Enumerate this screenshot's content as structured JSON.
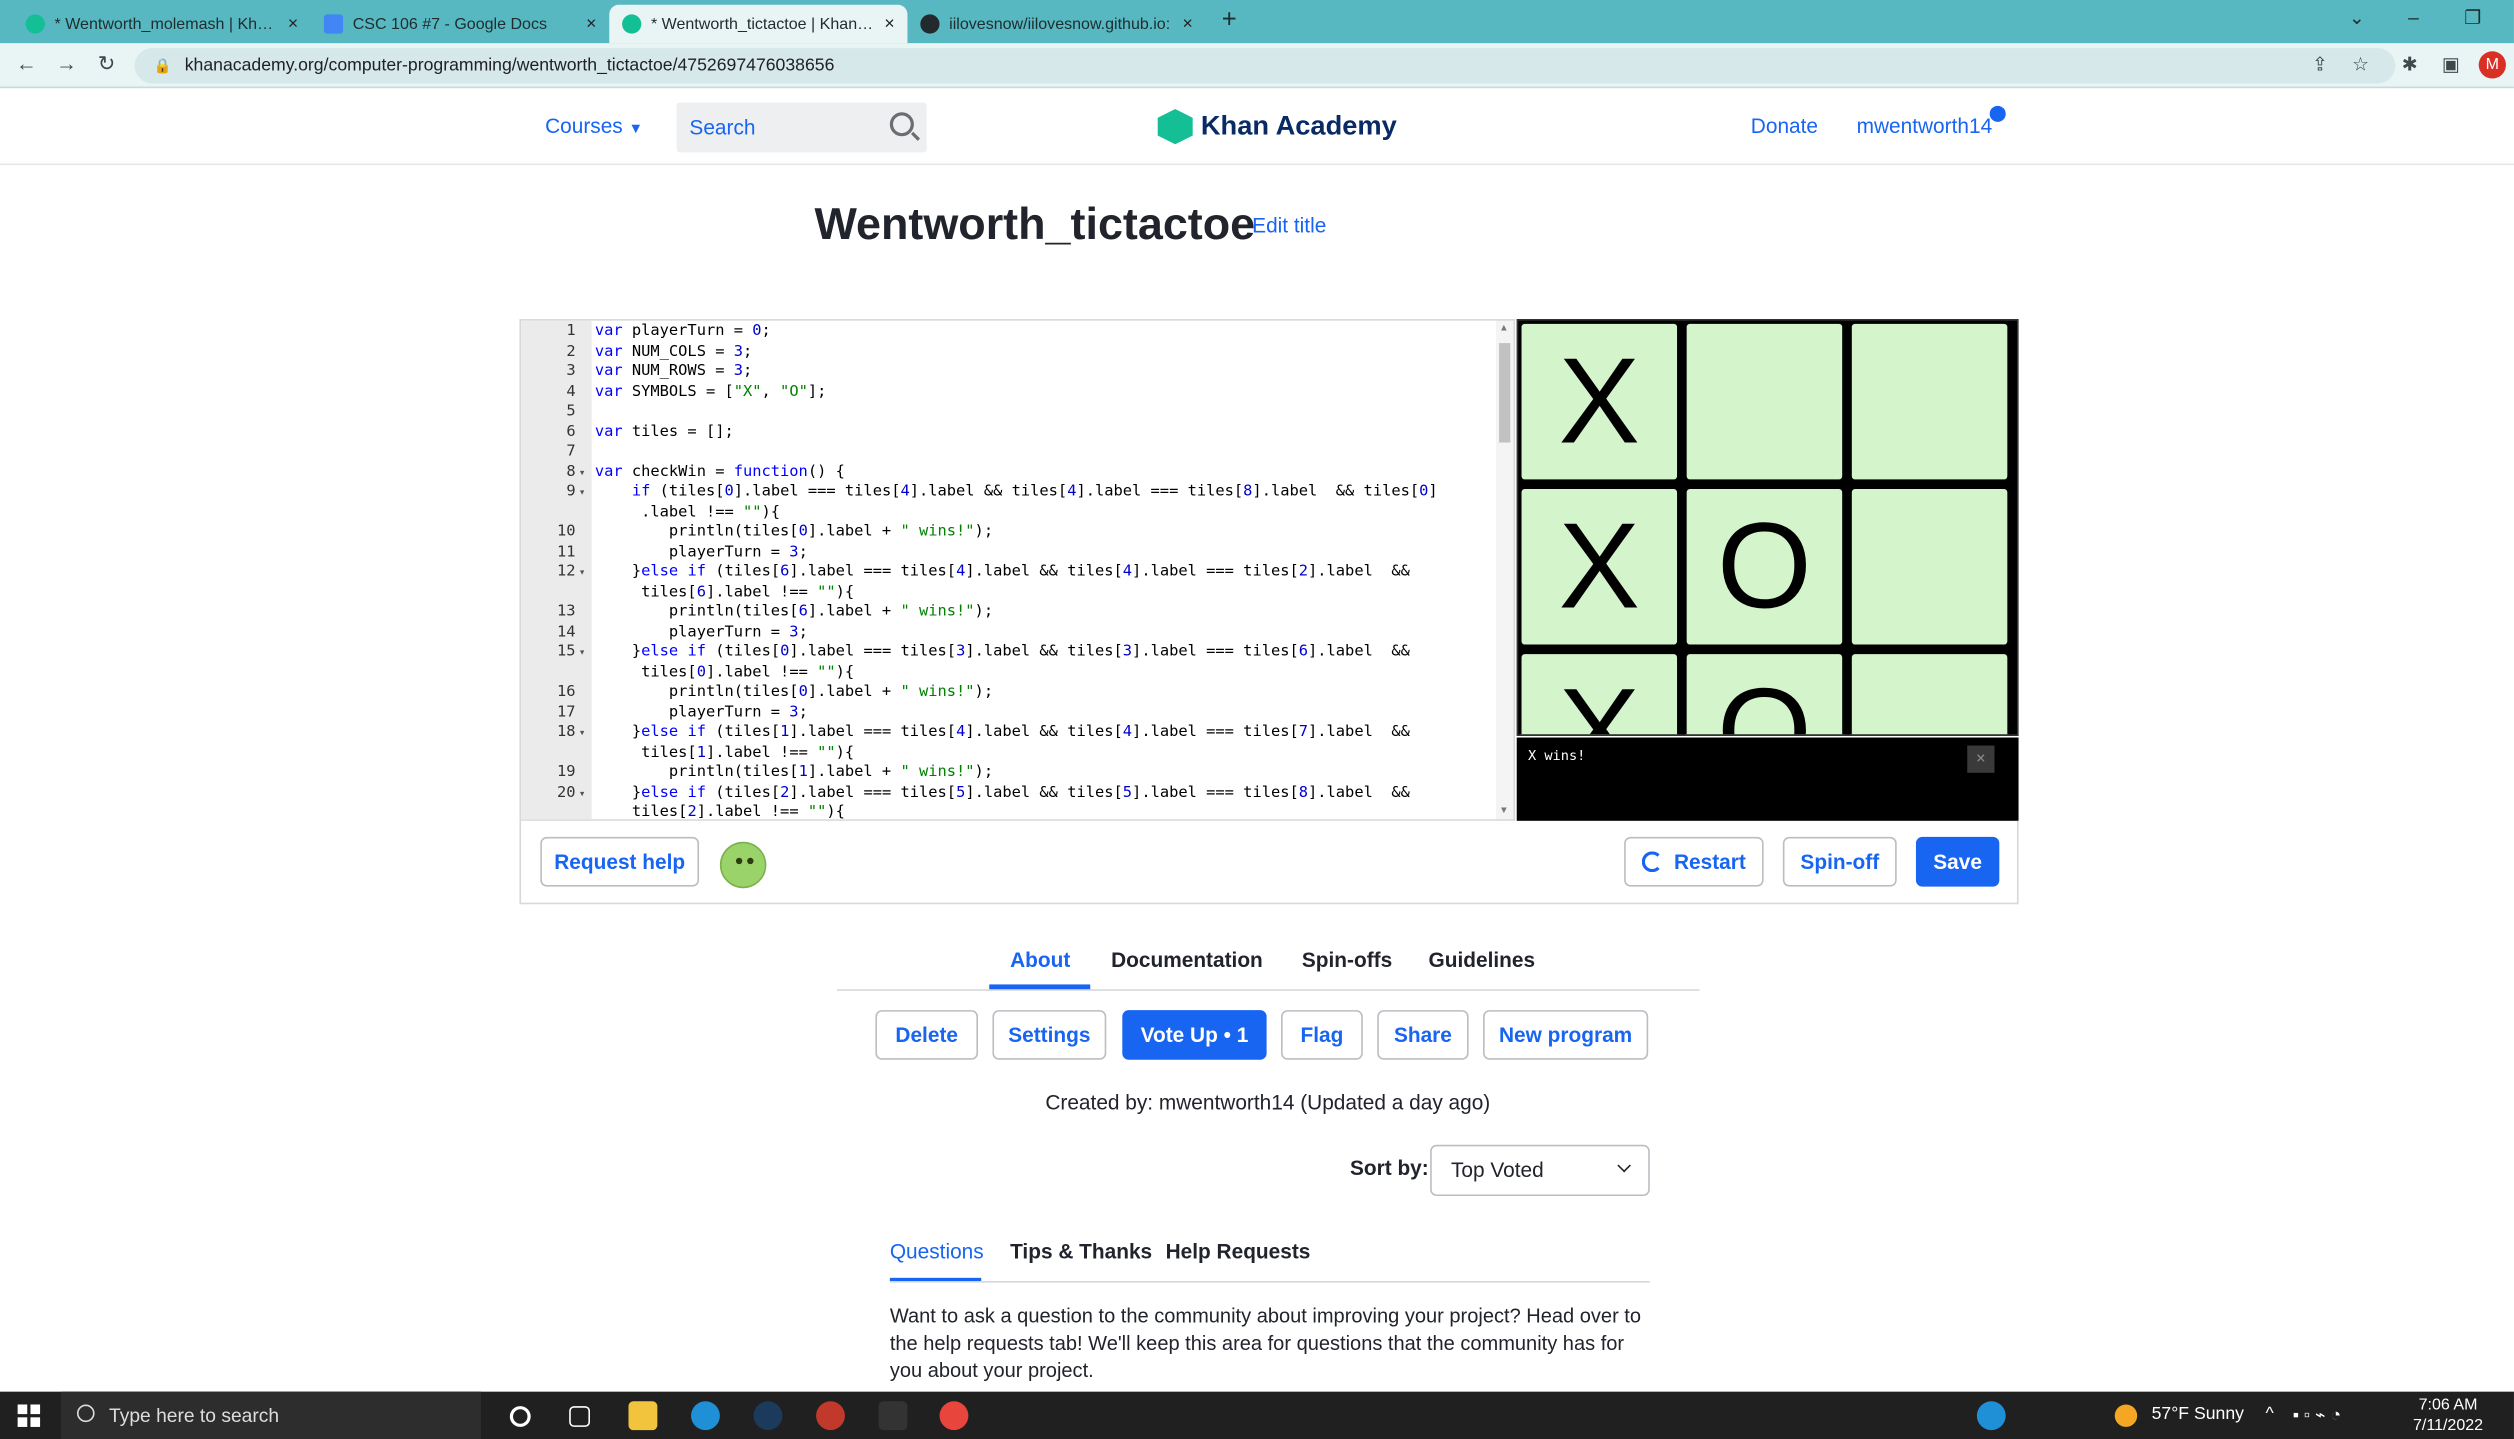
{
  "browser": {
    "tabs": [
      {
        "title": "* Wentworth_molemash | Khan A",
        "active": false
      },
      {
        "title": "CSC 106 #7 - Google Docs",
        "active": false
      },
      {
        "title": "* Wentworth_tictactoe | Khan Ac",
        "active": true
      },
      {
        "title": "iilovesnow/iilovesnow.github.io:",
        "active": false
      }
    ],
    "url": "khanacademy.org/computer-programming/wentworth_tictactoe/4752697476038656",
    "profile_initial": "M"
  },
  "header": {
    "courses": "Courses",
    "search_placeholder": "Search",
    "logo": "Khan Academy",
    "donate": "Donate",
    "username": "mwentworth14"
  },
  "program": {
    "title": "Wentworth_tictactoe",
    "edit_title": "Edit title"
  },
  "code_lines": [
    {
      "n": "1",
      "fold": "",
      "text": "var playerTurn = 0;"
    },
    {
      "n": "2",
      "fold": "",
      "text": "var NUM_COLS = 3;"
    },
    {
      "n": "3",
      "fold": "",
      "text": "var NUM_ROWS = 3;"
    },
    {
      "n": "4",
      "fold": "",
      "text": "var SYMBOLS = [\"X\", \"O\"];"
    },
    {
      "n": "5",
      "fold": "",
      "text": ""
    },
    {
      "n": "6",
      "fold": "",
      "text": "var tiles = [];"
    },
    {
      "n": "7",
      "fold": "",
      "text": ""
    },
    {
      "n": "8",
      "fold": "▾",
      "text": "var checkWin = function() {"
    },
    {
      "n": "9",
      "fold": "▾",
      "text": "    if (tiles[0].label === tiles[4].label && tiles[4].label === tiles[8].label  && tiles[0]"
    },
    {
      "n": "",
      "fold": "",
      "text": "     .label !== \"\"){"
    },
    {
      "n": "10",
      "fold": "",
      "text": "        println(tiles[0].label + \" wins!\");"
    },
    {
      "n": "11",
      "fold": "",
      "text": "        playerTurn = 3;"
    },
    {
      "n": "12",
      "fold": "▾",
      "text": "    }else if (tiles[6].label === tiles[4].label && tiles[4].label === tiles[2].label  &&"
    },
    {
      "n": "",
      "fold": "",
      "text": "     tiles[6].label !== \"\"){"
    },
    {
      "n": "13",
      "fold": "",
      "text": "        println(tiles[6].label + \" wins!\");"
    },
    {
      "n": "14",
      "fold": "",
      "text": "        playerTurn = 3;"
    },
    {
      "n": "15",
      "fold": "▾",
      "text": "    }else if (tiles[0].label === tiles[3].label && tiles[3].label === tiles[6].label  &&"
    },
    {
      "n": "",
      "fold": "",
      "text": "     tiles[0].label !== \"\"){"
    },
    {
      "n": "16",
      "fold": "",
      "text": "        println(tiles[0].label + \" wins!\");"
    },
    {
      "n": "17",
      "fold": "",
      "text": "        playerTurn = 3;"
    },
    {
      "n": "18",
      "fold": "▾",
      "text": "    }else if (tiles[1].label === tiles[4].label && tiles[4].label === tiles[7].label  &&"
    },
    {
      "n": "",
      "fold": "",
      "text": "     tiles[1].label !== \"\"){"
    },
    {
      "n": "19",
      "fold": "",
      "text": "        println(tiles[1].label + \" wins!\");"
    },
    {
      "n": "20",
      "fold": "▾",
      "text": "    }else if (tiles[2].label === tiles[5].label && tiles[5].label === tiles[8].label  &&"
    },
    {
      "n": "",
      "fold": "",
      "text": "    tiles[2].label !== \"\"){"
    }
  ],
  "board": {
    "cells": [
      "X",
      "",
      "",
      "X",
      "O",
      "",
      "X",
      "O",
      ""
    ]
  },
  "console": {
    "output": "X wins!",
    "close": "×"
  },
  "toolbar": {
    "request_help": "Request help",
    "restart": "Restart",
    "spin_off": "Spin-off",
    "save": "Save"
  },
  "page_tabs": [
    "About",
    "Documentation",
    "Spin-offs",
    "Guidelines"
  ],
  "actions": {
    "delete": "Delete",
    "settings": "Settings",
    "vote_up": "Vote Up • 1",
    "flag": "Flag",
    "share": "Share",
    "new_program": "New program"
  },
  "created_by": "Created by: mwentworth14 (Updated a day ago)",
  "sort": {
    "label": "Sort by:",
    "value": "Top Voted"
  },
  "question_tabs": [
    "Questions",
    "Tips & Thanks",
    "Help Requests"
  ],
  "questions_text": "Want to ask a question to the community about improving your project? Head over to the help requests tab! We'll keep this area for questions that the community has for you about your project.",
  "taskbar": {
    "search_placeholder": "Type here to search",
    "weather": "57°F  Sunny",
    "time": "7:06 AM",
    "date": "7/11/2022"
  },
  "colors": {
    "brand_blue": "#1865f2",
    "ka_green": "#14bf96",
    "tile_green": "#d4f5cc",
    "chrome_teal": "#57b8c2"
  }
}
